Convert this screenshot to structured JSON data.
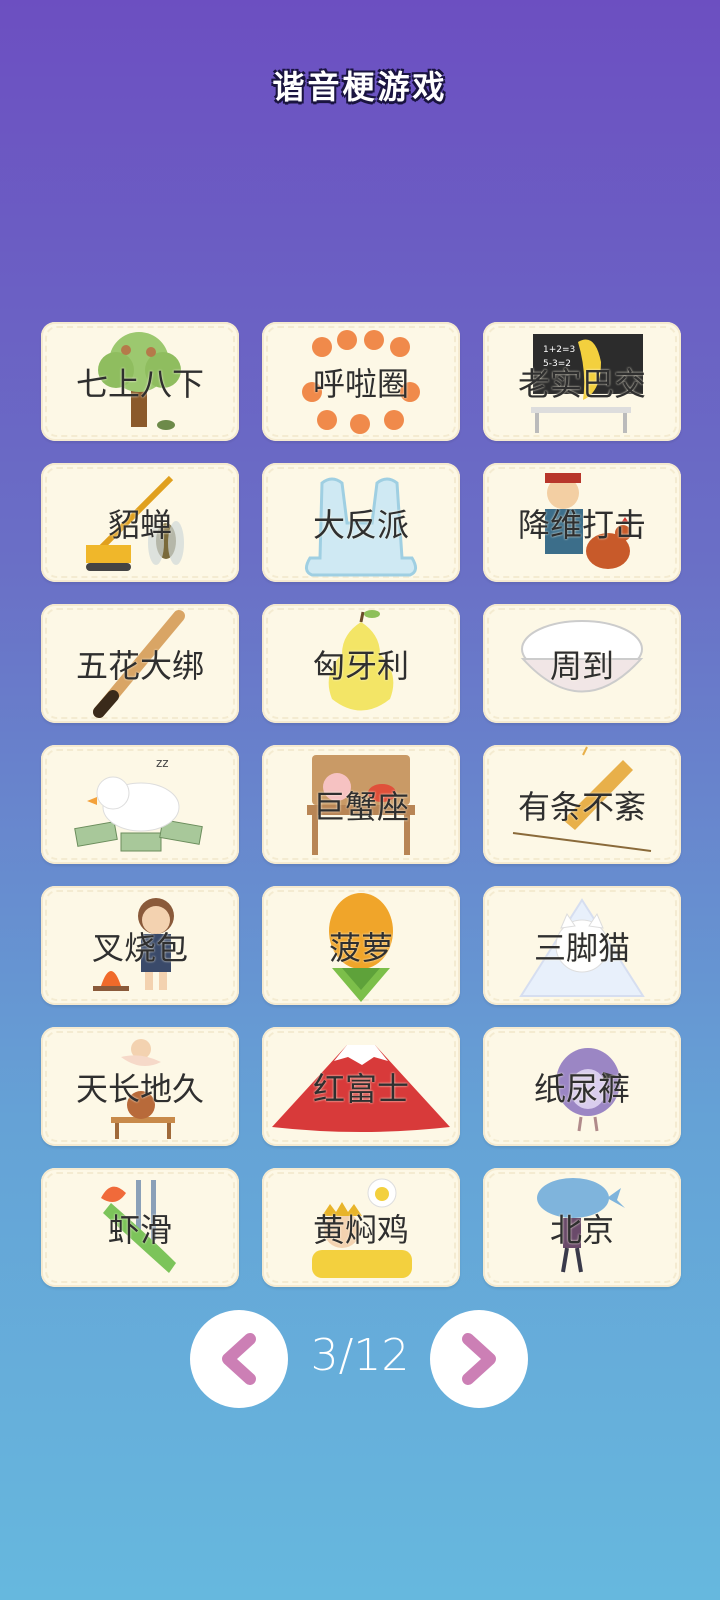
{
  "title": "谐音梗游戏",
  "colors": {
    "card_bg": "#fdf8e6",
    "arrow": "#cc7fb5",
    "text": "#2f2f2f"
  },
  "cards": [
    {
      "label": "七上八下",
      "icon": "tree-with-monkeys-icon"
    },
    {
      "label": "呼啦圈",
      "icon": "fox-circle-icon"
    },
    {
      "label": "老实巴交",
      "icon": "banana-teacher-icon"
    },
    {
      "label": "貂蝉",
      "icon": "crane-cicada-icon"
    },
    {
      "label": "大反派",
      "icon": "reverse-sign-icon"
    },
    {
      "label": "降维打击",
      "icon": "general-and-rooster-icon"
    },
    {
      "label": "五花大绑",
      "icon": "baseball-bat-icon"
    },
    {
      "label": "匈牙利",
      "icon": "pear-icon"
    },
    {
      "label": "周到",
      "icon": "rice-bowl-icon"
    },
    {
      "label": "",
      "icon": "duck-on-money-icon"
    },
    {
      "label": "巨蟹座",
      "icon": "pig-and-crab-bench-icon"
    },
    {
      "label": "有条不紊",
      "icon": "fried-dough-tightrope-icon"
    },
    {
      "label": "叉烧包",
      "icon": "boy-campfire-icon"
    },
    {
      "label": "菠萝",
      "icon": "pineapple-icon"
    },
    {
      "label": "三脚猫",
      "icon": "triangle-cat-icon"
    },
    {
      "label": "天长地久",
      "icon": "fairy-and-wine-icon"
    },
    {
      "label": "红富士",
      "icon": "red-mountain-icon"
    },
    {
      "label": "纸尿裤",
      "icon": "crying-bird-icon"
    },
    {
      "label": "虾滑",
      "icon": "shrimp-slide-icon"
    },
    {
      "label": "黄焖鸡",
      "icon": "sleeping-emperor-chick-icon"
    },
    {
      "label": "北京",
      "icon": "whale-backpack-icon"
    }
  ],
  "pager": {
    "current": "3/12",
    "prev_icon": "chevron-left-icon",
    "next_icon": "chevron-right-icon"
  }
}
